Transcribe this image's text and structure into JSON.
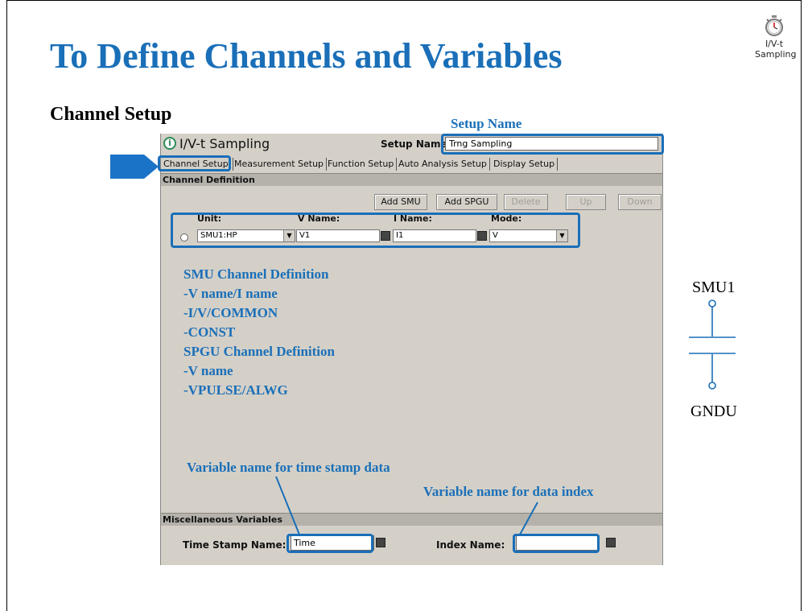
{
  "slide": {
    "title": "To Define Channels and Variables",
    "section_heading": "Channel Setup",
    "app_icon_label": "I/V-t Sampling"
  },
  "callouts": {
    "setup_name": "Setup Name",
    "time_stamp": "Variable name for time stamp data",
    "data_index": "Variable name for data index"
  },
  "notes": [
    "SMU Channel Definition",
    "-V name/I name",
    "-I/V/COMMON",
    "-CONST",
    "SPGU Channel Definition",
    "-V name",
    "-VPULSE/ALWG"
  ],
  "window": {
    "app_name": "I/V-t Sampling",
    "setup_name_label": "Setup Name:",
    "setup_name_value": "Trng Sampling",
    "tabs": [
      "Channel Setup",
      "Measurement Setup",
      "Function Setup",
      "Auto Analysis Setup",
      "Display Setup"
    ],
    "channel_definition_title": "Channel Definition",
    "buttons": {
      "add_smu": "Add SMU",
      "add_spgu": "Add SPGU",
      "delete": "Delete",
      "up": "Up",
      "down": "Down"
    },
    "columns": {
      "unit": "Unit:",
      "v_name": "V Name:",
      "i_name": "I Name:",
      "mode": "Mode:"
    },
    "row": {
      "unit": "SMU1:HP",
      "v_name": "V1",
      "i_name": "I1",
      "mode": "V"
    },
    "misc_title": "Miscellaneous Variables",
    "time_stamp_label": "Time Stamp Name:",
    "time_stamp_value": "Time",
    "index_label": "Index Name:",
    "index_value": ""
  },
  "circuit": {
    "top_label": "SMU1",
    "bottom_label": "GNDU"
  },
  "colors": {
    "accent_blue": "#1a6fb8",
    "window_gray": "#d4d0c8",
    "bar_gray": "#b5b2ab"
  }
}
